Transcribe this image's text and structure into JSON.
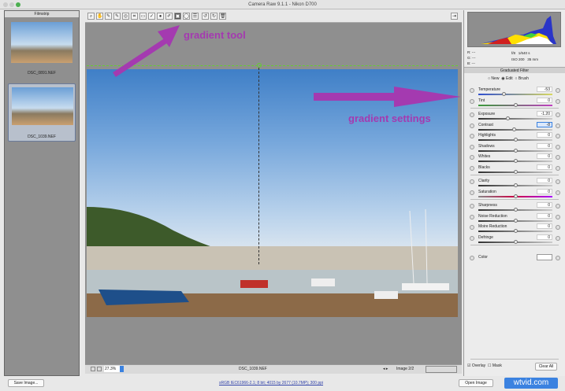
{
  "window": {
    "title": "Camera Raw 9.1.1  -  Nikon D700"
  },
  "filmstrip": {
    "title": "Filmstrip",
    "items": [
      {
        "name": "DSC_0891.NEF"
      },
      {
        "name": "DSC_1039.NEF",
        "selected": true
      }
    ]
  },
  "toolbar": {
    "tools": [
      "zoom-icon",
      "hand-icon",
      "white-balance-icon",
      "color-sampler-icon",
      "targeted-adjustment-icon",
      "crop-icon",
      "straighten-icon",
      "spot-removal-icon",
      "red-eye-icon",
      "adjustment-brush-icon",
      "graduated-filter-icon",
      "radial-filter-icon",
      "preferences-icon",
      "rotate-left-icon",
      "rotate-right-icon",
      "trash-icon"
    ],
    "active": "graduated-filter-icon"
  },
  "annotations": {
    "tool": "gradient tool",
    "settings": "gradient settings",
    "color": "#a43ab0"
  },
  "status": {
    "zoom": "27.3%",
    "filename": "DSC_1039.NEF",
    "image_count": "Image 2/2"
  },
  "info": {
    "r": "R:  ---",
    "g": "G:  ---",
    "b": "B:  ---",
    "aperture": "f/8",
    "shutter": "1/640 s",
    "iso": "ISO 200",
    "focal": "35 mm"
  },
  "panel": {
    "title": "Graduated Filter",
    "modes": [
      "New",
      "Edit",
      "Brush"
    ],
    "selected_mode": "Edit",
    "groups": [
      [
        {
          "label": "Temperature",
          "value": "-53",
          "pos": 0.35
        },
        {
          "label": "Tint",
          "value": "0",
          "pos": 0.5
        }
      ],
      [
        {
          "label": "Exposure",
          "value": "-1.20",
          "pos": 0.4
        },
        {
          "label": "Contrast",
          "value": "-8",
          "pos": 0.48
        },
        {
          "label": "Highlights",
          "value": "0",
          "pos": 0.5
        },
        {
          "label": "Shadows",
          "value": "0",
          "pos": 0.5
        },
        {
          "label": "Whites",
          "value": "0",
          "pos": 0.5
        },
        {
          "label": "Blacks",
          "value": "0",
          "pos": 0.5
        }
      ],
      [
        {
          "label": "Clarity",
          "value": "0",
          "pos": 0.5
        },
        {
          "label": "Saturation",
          "value": "0",
          "pos": 0.5
        }
      ],
      [
        {
          "label": "Sharpness",
          "value": "0",
          "pos": 0.5
        },
        {
          "label": "Noise Reduction",
          "value": "0",
          "pos": 0.5
        },
        {
          "label": "Moire Reduction",
          "value": "0",
          "pos": 0.5
        },
        {
          "label": "Defringe",
          "value": "0",
          "pos": 0.5
        }
      ]
    ],
    "color_label": "Color",
    "overlay": "Overlay",
    "overlay_checked": true,
    "mask": "Mask",
    "mask_checked": false,
    "clear_all": "Clear All"
  },
  "footer": {
    "save": "Save Image...",
    "workflow": "sRGB IEC61966-2.1; 8 bit; 4015 by 2677 (10.7MP); 300 ppi",
    "open": "Open Image",
    "watermark": "wtvid.com"
  }
}
